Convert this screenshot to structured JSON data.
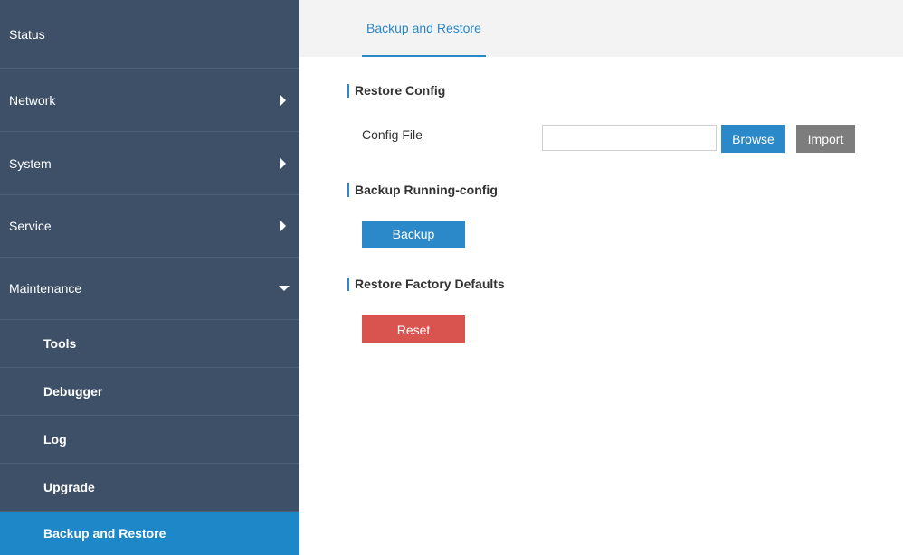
{
  "sidebar": {
    "items": [
      {
        "label": "Status"
      },
      {
        "label": "Network"
      },
      {
        "label": "System"
      },
      {
        "label": "Service"
      },
      {
        "label": "Maintenance"
      }
    ],
    "sub_items": [
      {
        "label": "Tools"
      },
      {
        "label": "Debugger"
      },
      {
        "label": "Log"
      },
      {
        "label": "Upgrade"
      },
      {
        "label": "Backup and Restore"
      }
    ]
  },
  "main": {
    "tab": "Backup and Restore",
    "restore_config": {
      "title": "Restore Config",
      "field_label": "Config File",
      "file_value": "",
      "browse_label": "Browse",
      "import_label": "Import"
    },
    "backup": {
      "title": "Backup Running-config",
      "button_label": "Backup"
    },
    "factory": {
      "title": "Restore Factory Defaults",
      "button_label": "Reset"
    }
  },
  "colors": {
    "sidebar_bg": "#3d5068",
    "accent": "#2b88c9",
    "active_item": "#1d87c8",
    "reset": "#d9534f",
    "import": "#7d7d7d"
  }
}
